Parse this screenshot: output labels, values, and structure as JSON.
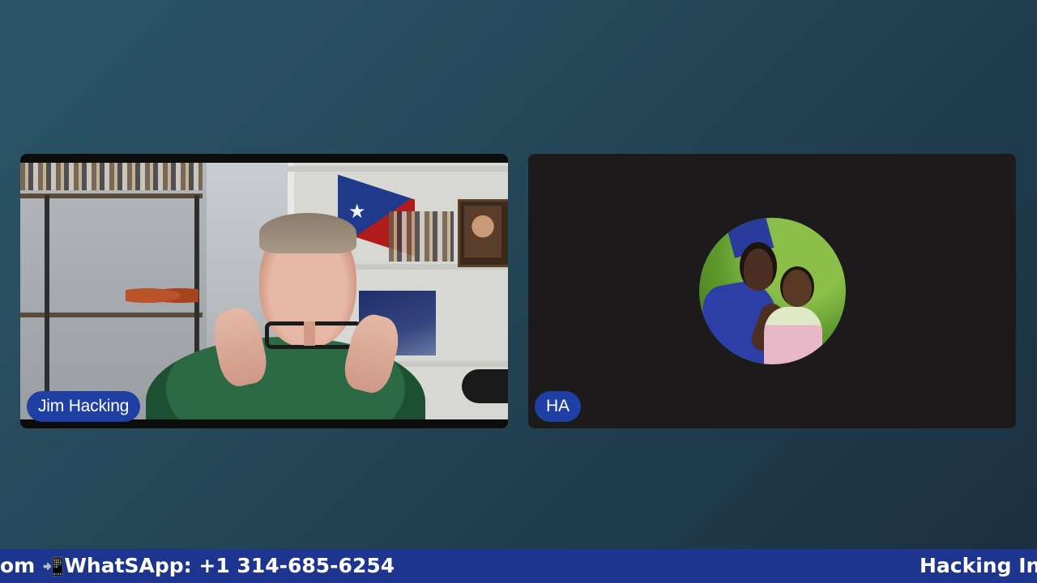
{
  "participants": [
    {
      "name_tag": "Jim Hacking",
      "video": "camera-feed"
    },
    {
      "name_tag": "HA",
      "video": "avatar-photo"
    }
  ],
  "ticker": {
    "lead_text": "om ",
    "icon": "mobile-phone-arrow-icon",
    "icon_glyph": "📲",
    "whatsapp_text": "WhatSApp: +1 314-685-6254",
    "trailing_text": "Hacking In"
  },
  "colors": {
    "background_top": "#2a5566",
    "background_bottom": "#1a2f40",
    "name_tag": "#1f3fa4",
    "ticker_bar": "#1e3590"
  }
}
